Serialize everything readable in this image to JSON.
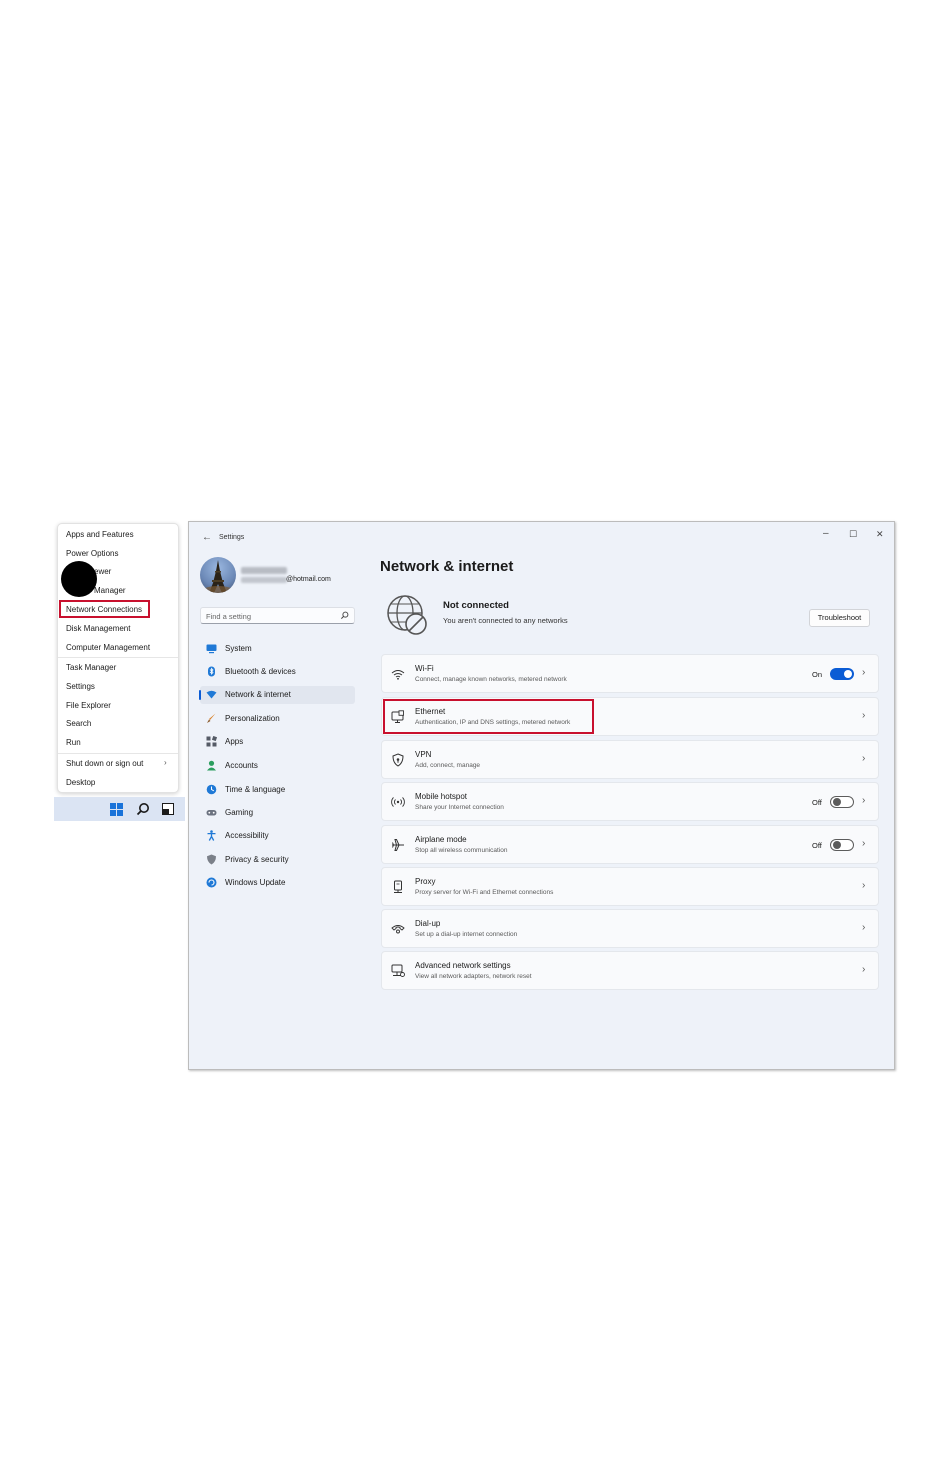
{
  "context_menu": {
    "items": [
      {
        "label": "Apps and Features"
      },
      {
        "label": "Power Options"
      },
      {
        "label": "ewer"
      },
      {
        "label": "Manager"
      },
      {
        "label": "Network Connections"
      },
      {
        "label": "Disk Management"
      },
      {
        "label": "Computer Management"
      },
      {
        "label": "Task Manager"
      },
      {
        "label": "Settings"
      },
      {
        "label": "File Explorer"
      },
      {
        "label": "Search"
      },
      {
        "label": "Run"
      },
      {
        "label": "Shut down or sign out"
      },
      {
        "label": "Desktop"
      }
    ],
    "submenu_arrow": "›",
    "highlighted_item": "Network Connections"
  },
  "taskbar": {
    "icons": [
      "windows-start-icon",
      "search-icon",
      "task-view-icon"
    ]
  },
  "settings": {
    "back_glyph": "←",
    "window_title": "Settings",
    "controls": {
      "minimize": "–",
      "maximize": "☐",
      "close": "✕"
    },
    "profile": {
      "email_domain": "@hotmail.com"
    },
    "search": {
      "placeholder": "Find a setting"
    },
    "nav": [
      {
        "label": "System",
        "icon": "monitor-icon",
        "active": false
      },
      {
        "label": "Bluetooth & devices",
        "icon": "bluetooth-icon",
        "active": false
      },
      {
        "label": "Network & internet",
        "icon": "wifi-diamond-icon",
        "active": true
      },
      {
        "label": "Personalization",
        "icon": "brush-icon",
        "active": false
      },
      {
        "label": "Apps",
        "icon": "apps-icon",
        "active": false
      },
      {
        "label": "Accounts",
        "icon": "person-icon",
        "active": false
      },
      {
        "label": "Time & language",
        "icon": "clock-globe-icon",
        "active": false
      },
      {
        "label": "Gaming",
        "icon": "gamepad-icon",
        "active": false
      },
      {
        "label": "Accessibility",
        "icon": "accessibility-icon",
        "active": false
      },
      {
        "label": "Privacy & security",
        "icon": "shield-icon",
        "active": false
      },
      {
        "label": "Windows Update",
        "icon": "update-icon",
        "active": false
      }
    ],
    "page_title": "Network & internet",
    "status": {
      "title": "Not connected",
      "subtitle": "You aren't connected to any networks",
      "troubleshoot": "Troubleshoot"
    },
    "cards": [
      {
        "title": "Wi-Fi",
        "subtitle": "Connect, manage known networks, metered network",
        "toggle_label": "On",
        "toggle": "on",
        "icon": "wifi-icon"
      },
      {
        "title": "Ethernet",
        "subtitle": "Authentication, IP and DNS settings, metered network",
        "icon": "ethernet-icon",
        "highlighted": true
      },
      {
        "title": "VPN",
        "subtitle": "Add, connect, manage",
        "icon": "vpn-shield-icon"
      },
      {
        "title": "Mobile hotspot",
        "subtitle": "Share your Internet connection",
        "toggle_label": "Off",
        "toggle": "off",
        "icon": "hotspot-icon"
      },
      {
        "title": "Airplane mode",
        "subtitle": "Stop all wireless communication",
        "toggle_label": "Off",
        "toggle": "off",
        "icon": "airplane-icon"
      },
      {
        "title": "Proxy",
        "subtitle": "Proxy server for Wi-Fi and Ethernet connections",
        "icon": "proxy-icon"
      },
      {
        "title": "Dial-up",
        "subtitle": "Set up a dial-up internet connection",
        "icon": "dialup-icon"
      },
      {
        "title": "Advanced network settings",
        "subtitle": "View all network adapters, network reset",
        "icon": "advanced-network-icon"
      }
    ],
    "chevron": "›"
  },
  "colors": {
    "accent": "#0b5cd5",
    "highlight_box": "#c8102e",
    "window_bg": "#eef2f9",
    "card_bg": "#f9fafc",
    "callout": "#000000"
  }
}
